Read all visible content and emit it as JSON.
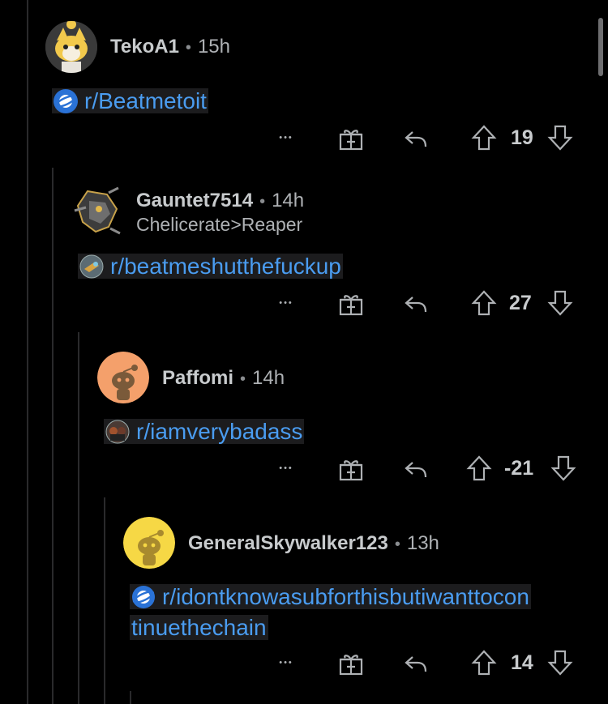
{
  "comments": [
    {
      "username": "TekoA1",
      "time": "15h",
      "flair": "",
      "link": "r/Beatmetoit",
      "link_line2": "",
      "score": "19",
      "avatar_color": "#f2c94c"
    },
    {
      "username": "Gauntet7514",
      "time": "14h",
      "flair": "Chelicerate>Reaper",
      "link": "r/beatmeshutthefuckup",
      "link_line2": "",
      "score": "27",
      "avatar_color": "#3a3a3a"
    },
    {
      "username": "Paffomi",
      "time": "14h",
      "flair": "",
      "link": "r/iamverybadass",
      "link_line2": "",
      "score": "-21",
      "avatar_color": "#f4a06b"
    },
    {
      "username": "GeneralSkywalker123",
      "time": "13h",
      "flair": "",
      "link": "r/idontknowasubforthisbutiwanttocon",
      "link_line2": "tinuethechain",
      "score": "14",
      "avatar_color": "#f6d845"
    }
  ],
  "ui": {
    "separator": "•",
    "more_glyph": "•••"
  },
  "colors": {
    "background": "#000000",
    "link": "#4a9cf0",
    "text": "#c8cbcd",
    "muted": "#aeb1b4"
  },
  "icons": [
    "more-icon",
    "gift-icon",
    "reply-icon",
    "upvote-icon",
    "downvote-icon",
    "planet-icon",
    "snoo-avatar-icon"
  ]
}
